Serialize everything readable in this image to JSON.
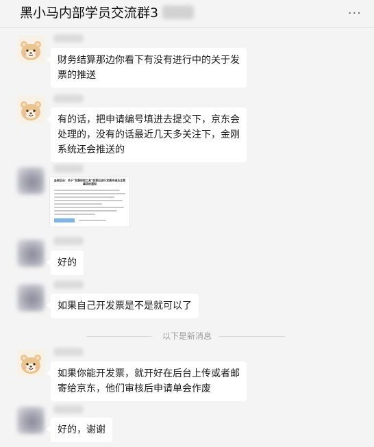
{
  "header": {
    "title": "黑小马内部学员交流群3",
    "more_icon": "more-horizontal-icon",
    "more_glyph": "···"
  },
  "messages": [
    {
      "avatar": "cartoon-cat-avatar",
      "text": "财务结算那边你看下有没有进行中的关于发票的推送"
    },
    {
      "avatar": "cartoon-cat-avatar",
      "text": "有的话，把申请编号填进去提交下，京东会处理的，没有的话最近几天多关注下，金刚系统还会推送的"
    },
    {
      "avatar": "blurred-avatar",
      "type": "image",
      "image_title": "金刚后台：关于\"发票校验工具\"变更后进行发票申请及注意事项的通知"
    },
    {
      "avatar": "blurred-avatar",
      "text": "好的"
    },
    {
      "avatar": "blurred-avatar",
      "text": "如果自己开发票是不是就可以了"
    },
    {
      "avatar": "cartoon-cat-avatar",
      "text": "如果你能开发票，就开好在后台上传或者邮寄给京东，他们审核后申请单会作废"
    },
    {
      "avatar": "blurred-avatar",
      "text": "好的，谢谢"
    }
  ],
  "divider": {
    "label": "以下是新消息"
  },
  "colors": {
    "background": "#f4f4f4",
    "bubble": "#ffffff",
    "divider_text": "#9a9a9a"
  }
}
